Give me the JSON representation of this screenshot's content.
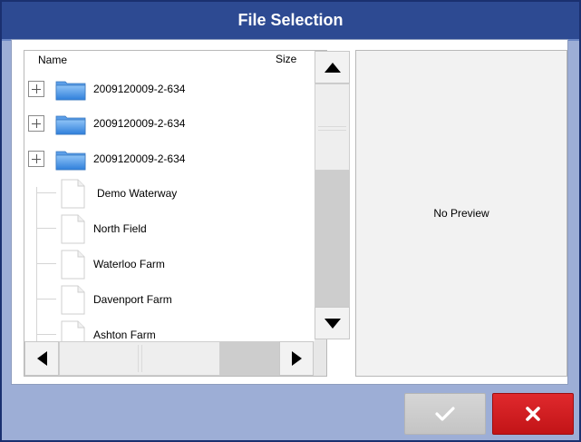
{
  "dialog": {
    "title": "File Selection",
    "columns": {
      "name": "Name",
      "size": "Size"
    },
    "items": [
      {
        "type": "folder",
        "label": "2009120009-2-634",
        "icon": "folder-icon"
      },
      {
        "type": "folder",
        "label": "2009120009-2-634",
        "icon": "folder-icon"
      },
      {
        "type": "folder",
        "label": "2009120009-2-634",
        "icon": "folder-icon"
      },
      {
        "type": "file",
        "label": "Demo Waterway",
        "icon": "document-icon"
      },
      {
        "type": "file",
        "label": "North Field",
        "icon": "document-icon"
      },
      {
        "type": "file",
        "label": "Waterloo Farm",
        "icon": "document-icon"
      },
      {
        "type": "file",
        "label": "Davenport Farm",
        "icon": "document-icon"
      },
      {
        "type": "file",
        "label": "Ashton Farm",
        "icon": "document-icon"
      }
    ],
    "preview_text": "No Preview",
    "buttons": {
      "ok_icon": "checkmark-icon",
      "cancel_icon": "x-icon"
    }
  },
  "colors": {
    "title_bar": "#2d4a92",
    "dialog_background": "#9daed6",
    "cancel_button": "#d61f23",
    "ok_button": "#cccccc",
    "folder": "#4a90e2"
  }
}
